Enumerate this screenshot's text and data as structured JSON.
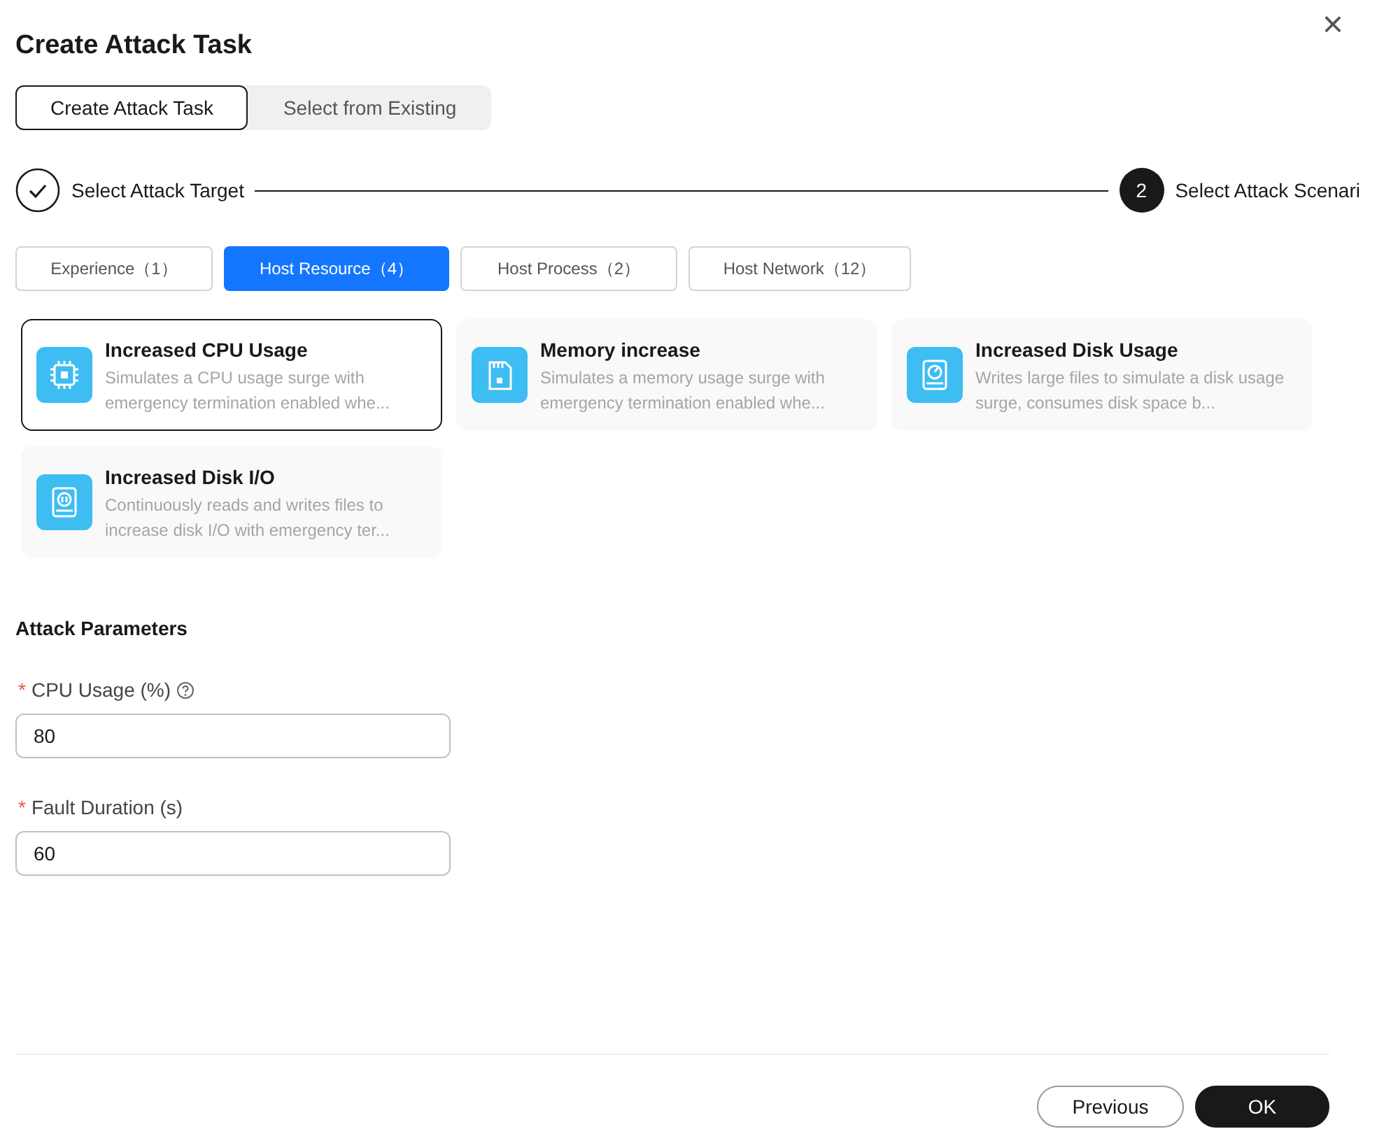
{
  "dialog": {
    "title": "Create Attack Task",
    "close": "×"
  },
  "mode_switch": [
    {
      "label": "Create Attack Task",
      "selected": true
    },
    {
      "label": "Select from Existing",
      "selected": false
    }
  ],
  "steps": [
    {
      "label": "Select Attack Target",
      "kind": "done"
    },
    {
      "number": "2",
      "label": "Select Attack Scenari",
      "kind": "current"
    }
  ],
  "categories": [
    {
      "label": "Experience（1）",
      "selected": false
    },
    {
      "label": "Host Resource（4）",
      "selected": true
    },
    {
      "label": "Host Process（2）",
      "selected": false
    },
    {
      "label": "Host Network（12）",
      "selected": false
    }
  ],
  "scenarios": [
    {
      "kind": "cpu",
      "title": "Increased CPU Usage",
      "description": "Simulates a CPU usage surge with emergency termination enabled whe...",
      "selected": true
    },
    {
      "kind": "memory",
      "title": "Memory increase",
      "description": "Simulates a memory usage surge with emergency termination enabled whe...",
      "selected": false
    },
    {
      "kind": "disk",
      "title": "Increased Disk Usage",
      "description": "Writes large files to simulate a disk usage surge, consumes disk space b...",
      "selected": false
    },
    {
      "kind": "diskio",
      "title": "Increased Disk I/O",
      "description": "Continuously reads and writes files to increase disk I/O with emergency ter...",
      "selected": false
    }
  ],
  "parameters": {
    "title": "Attack Parameters",
    "fields": [
      {
        "required_mark": "*",
        "label": "CPU Usage (%)",
        "help": true,
        "value": "80"
      },
      {
        "required_mark": "*",
        "label": "Fault Duration (s)",
        "help": false,
        "value": "60"
      }
    ]
  },
  "footer": {
    "buttons": [
      {
        "label": "Previous",
        "kind": "secondary"
      },
      {
        "label": "OK",
        "kind": "primary"
      }
    ]
  }
}
